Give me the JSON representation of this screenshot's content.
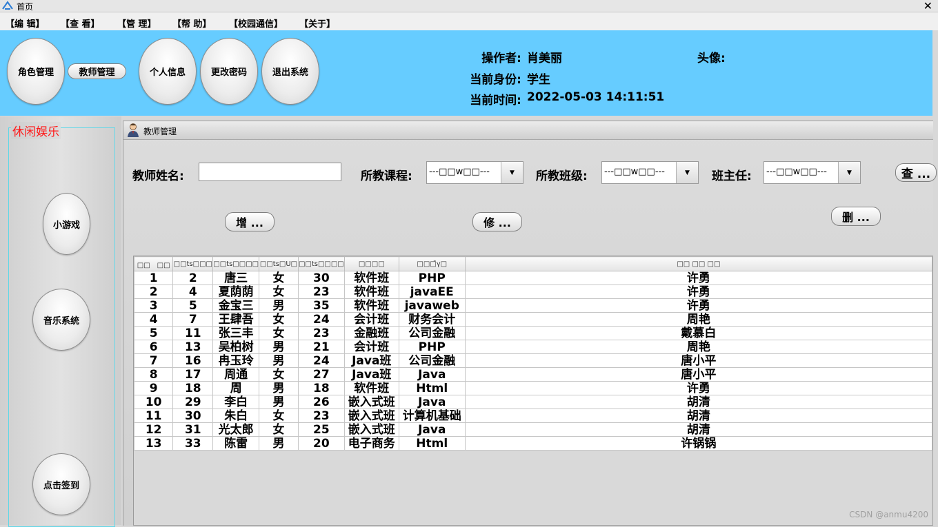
{
  "window": {
    "title": "首页",
    "close_glyph": "✕"
  },
  "menu": [
    "【编 辑】",
    "【查 看】",
    "【管 理】",
    "【帮 助】",
    "【校园通信】",
    "【关于】"
  ],
  "header": {
    "role_button": "角色管理",
    "teacher_button": "教师管理",
    "personal_button": "个人信息",
    "password_button": "更改密码",
    "logout_button": "退出系统",
    "operator_label": "操作者:",
    "operator_value": "肖美丽",
    "identity_label": "当前身份:",
    "identity_value": "学生",
    "time_label": "当前时间:",
    "time_value": "2022-05-03 14:11:51",
    "avatar_label": "头像:"
  },
  "leisure": {
    "title": "休闲娱乐",
    "game_button": "小游戏",
    "music_button": "音乐系统",
    "signin_button": "点击签到"
  },
  "frame": {
    "title": "教师管理",
    "name_label": "教师姓名:",
    "name_value": "",
    "course_label": "所教课程:",
    "course_value": "---□□w□□---",
    "class_label": "所教班级:",
    "class_value": "---□□w□□---",
    "head_label": "班主任:",
    "head_value": "---□□w□□---",
    "query_button": "查 ...",
    "add_button": "增 ...",
    "edit_button": "修 ...",
    "delete_button": "删 ..."
  },
  "table": {
    "headers": [
      "□□　□□",
      "□□ts□□□",
      "□□ts□□□□",
      "□□ts□U□",
      "□□ts□□□□",
      "□□□□",
      "□□□̄γ□",
      "□□ □□ □□"
    ],
    "rows": [
      [
        "1",
        "2",
        "唐三",
        "女",
        "30",
        "软件班",
        "PHP",
        "许勇"
      ],
      [
        "2",
        "4",
        "夏荫荫",
        "女",
        "23",
        "软件班",
        "javaEE",
        "许勇"
      ],
      [
        "3",
        "5",
        "金宝三",
        "男",
        "35",
        "软件班",
        "javaweb",
        "许勇"
      ],
      [
        "4",
        "7",
        "王肆吾",
        "女",
        "24",
        "会计班",
        "财务会计",
        "周艳"
      ],
      [
        "5",
        "11",
        "张三丰",
        "女",
        "23",
        "金融班",
        "公司金融",
        "戴慕白"
      ],
      [
        "6",
        "13",
        "吴柏树",
        "男",
        "21",
        "会计班",
        "PHP",
        "周艳"
      ],
      [
        "7",
        "16",
        "冉玉玲",
        "男",
        "24",
        "Java班",
        "公司金融",
        "唐小平"
      ],
      [
        "8",
        "17",
        "周通",
        "女",
        "27",
        "Java班",
        "Java",
        "唐小平"
      ],
      [
        "9",
        "18",
        "周",
        "男",
        "18",
        "软件班",
        "Html",
        "许勇"
      ],
      [
        "10",
        "29",
        "李白",
        "男",
        "26",
        "嵌入式班",
        "Java",
        "胡清"
      ],
      [
        "11",
        "30",
        "朱白",
        "女",
        "23",
        "嵌入式班",
        "计算机基础",
        "胡清"
      ],
      [
        "12",
        "31",
        "光太郎",
        "女",
        "25",
        "嵌入式班",
        "Java",
        "胡清"
      ],
      [
        "13",
        "33",
        "陈雷",
        "男",
        "20",
        "电子商务",
        "Html",
        "许锅锅"
      ]
    ]
  },
  "watermark": "CSDN @anmu4200",
  "colors": {
    "header_bg": "#66ccff",
    "leisure_title": "#ff1a1a",
    "leisure_border": "#5fd7e8"
  }
}
